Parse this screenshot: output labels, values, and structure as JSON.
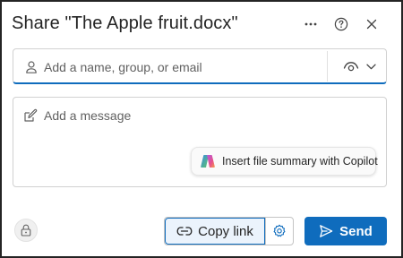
{
  "dialog": {
    "title": "Share \"The Apple fruit.docx\""
  },
  "header": {
    "more_icon": "more-horizontal-icon",
    "help_icon": "question-circle-icon",
    "close_icon": "dismiss-icon"
  },
  "people_picker": {
    "placeholder": "Add a name, group, or email",
    "value": "",
    "leading_icon": "person-icon",
    "permission_icon": "eye-icon",
    "dropdown_icon": "chevron-down-icon"
  },
  "message": {
    "placeholder": "Add a message",
    "value": "",
    "leading_icon": "compose-icon"
  },
  "copilot": {
    "label": "Insert file summary with Copilot",
    "icon": "copilot-icon"
  },
  "footer": {
    "lock_icon": "lock-icon",
    "copy_link_label": "Copy link",
    "copy_link_icon": "link-icon",
    "settings_icon": "gear-icon",
    "send_label": "Send",
    "send_icon": "send-icon"
  },
  "colors": {
    "accent": "#0f6cbd",
    "text": "#242424",
    "placeholder": "#616161",
    "border": "#d1d1d1"
  }
}
